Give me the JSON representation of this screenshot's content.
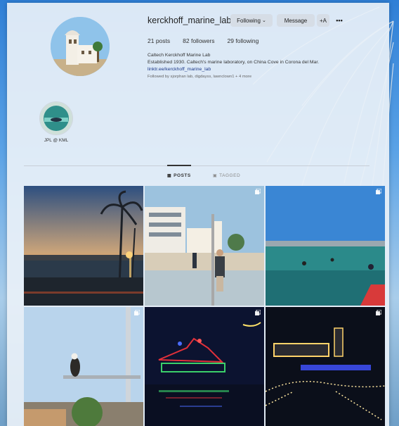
{
  "profile": {
    "username": "kerckhoff_marine_lab",
    "following_button": "Following",
    "message_button": "Message",
    "add_person_icon": "+A",
    "more_icon": "•••",
    "stats": {
      "posts": "21 posts",
      "followers": "82 followers",
      "following": "29 following"
    },
    "bio": {
      "name": "Caltech Kerckhoff Marine Lab",
      "description": "Established 1930. Caltech's marine laboratory, on China Cove in Corona del Mar.",
      "link": "linktr.ee/kerckhoff_marine_lab",
      "followed_by": "Followed by sjorphan lab, digdayss, lawnclown1 + 4 more"
    }
  },
  "highlight": {
    "label": "JPL @ KML"
  },
  "tabs": {
    "posts": "POSTS",
    "tagged": "TAGGED"
  },
  "posts": [
    {
      "scene": "harbor sunset with palm trees",
      "multi": false
    },
    {
      "scene": "beach with building and person holding pole",
      "multi": true
    },
    {
      "scene": "people swimming in bay with kayak",
      "multi": true
    },
    {
      "scene": "osprey perched on mast",
      "multi": true
    },
    {
      "scene": "boat with holiday lights at night",
      "multi": true
    },
    {
      "scene": "lighted boat parade at night",
      "multi": true
    }
  ]
}
